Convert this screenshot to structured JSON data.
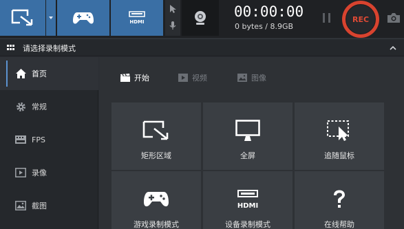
{
  "toolbar": {
    "timer": "00:00:00",
    "size": "0 bytes / 8.9GB",
    "rec_label": "REC",
    "hdmi_label": "HDMI"
  },
  "modebar": {
    "title": "请选择录制模式"
  },
  "sidebar": {
    "items": [
      {
        "label": "首页",
        "icon": "home-icon",
        "active": true
      },
      {
        "label": "常规",
        "icon": "gear-icon",
        "active": false
      },
      {
        "label": "FPS",
        "icon": "fps-icon",
        "active": false
      },
      {
        "label": "录像",
        "icon": "video-icon",
        "active": false
      },
      {
        "label": "截图",
        "icon": "image-icon",
        "active": false
      }
    ]
  },
  "tabs": [
    {
      "label": "开始",
      "icon": "clapper-icon",
      "active": true
    },
    {
      "label": "视频",
      "icon": "play-icon",
      "active": false
    },
    {
      "label": "图像",
      "icon": "picture-icon",
      "active": false
    }
  ],
  "tiles": [
    {
      "label": "矩形区域",
      "icon": "rectangle-area-icon"
    },
    {
      "label": "全屏",
      "icon": "monitor-icon"
    },
    {
      "label": "追随鼠标",
      "icon": "follow-mouse-icon"
    },
    {
      "label": "游戏录制模式",
      "icon": "gamepad-icon"
    },
    {
      "label": "设备录制模式",
      "icon": "hdmi-icon"
    },
    {
      "label": "在线帮助",
      "icon": "question-icon"
    }
  ],
  "colors": {
    "accent_blue": "#3a6fa5",
    "rec_red": "#d8432f",
    "tile_bg": "#3a3e43"
  }
}
